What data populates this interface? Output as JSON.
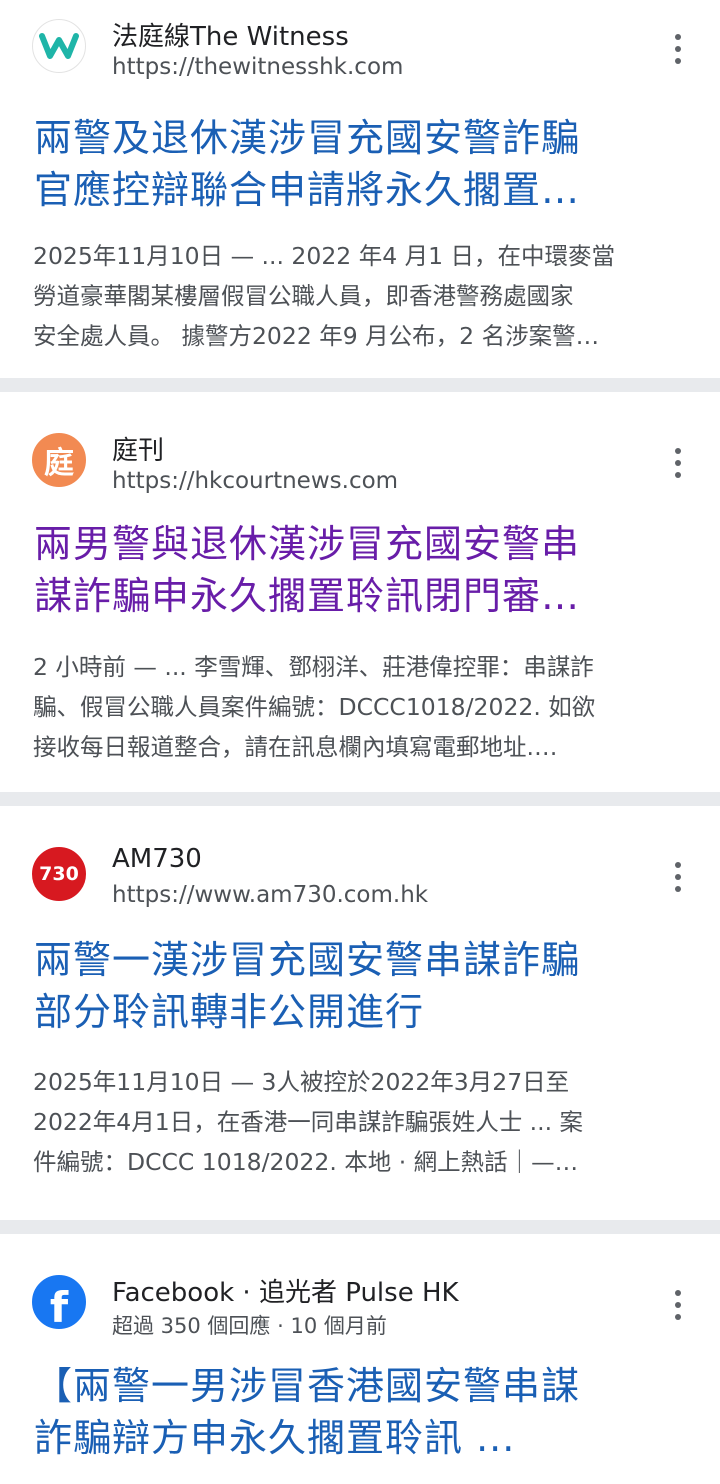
{
  "results": [
    {
      "site_name": "法庭線The Witness",
      "url": "https://thewitnesshk.com",
      "title_line1": "兩警及退休漢涉冒充國安警詐騙",
      "title_line2": "官應控辯聯合申請將永久擱置…",
      "snippet_line1": "2025年11月10日 — ... 2022 年4 月1 日，在中環麥當",
      "snippet_line2": "勞道豪華閣某樓層假冒公職人員，即香港警務處國家",
      "snippet_line3": "安全處人員。 據警方2022 年9 月公布，2 名涉案警…",
      "favicon_icon": "witness-w-logo-icon",
      "favicon_text": "W",
      "favicon_color": "#1fb5a8"
    },
    {
      "site_name": "庭刊",
      "url": "https://hkcourtnews.com",
      "title_line1": "兩男警與退休漢涉冒充國安警串",
      "title_line2": "謀詐騙申永久擱置聆訊閉門審…",
      "snippet_line1": "2 小時前 — ... 李雪輝、鄧栩洋、莊港偉控罪：串謀詐",
      "snippet_line2": "騙、假冒公職人員案件編號：DCCC1018/2022. 如欲",
      "snippet_line3": "接收每日報道整合，請在訊息欄內填寫電郵地址.…",
      "favicon_icon": "hkcourtnews-logo-icon",
      "favicon_text": "庭",
      "favicon_color": "#f28a52"
    },
    {
      "site_name": "AM730",
      "url": "https://www.am730.com.hk",
      "title_line1": "兩警一漢涉冒充國安警串謀詐騙",
      "title_line2": "部分聆訊轉非公開進行",
      "snippet_line1": "2025年11月10日 — 3人被控於2022年3月27日至",
      "snippet_line2": "2022年4月1日，在香港一同串謀詐騙張姓人士 ... 案",
      "snippet_line3": "件編號：DCCC 1018/2022. 本地 · 網上熱話｜—…",
      "favicon_icon": "am730-logo-icon",
      "favicon_text": "730",
      "favicon_color": "#d71920"
    },
    {
      "site_name": "Facebook · 追光者 Pulse HK",
      "meta": "超過 350 個回應 · 10 個月前",
      "title_line1": "【兩警一男涉冒香港國安警串謀",
      "title_line2": "詐騙辯方申永久擱置聆訊 ...",
      "favicon_icon": "facebook-logo-icon",
      "favicon_text": "f",
      "favicon_color": "#1877f2"
    }
  ],
  "colors": {
    "link": "#1a5fb4",
    "visited": "#681da8",
    "snippet": "#4d5156"
  }
}
